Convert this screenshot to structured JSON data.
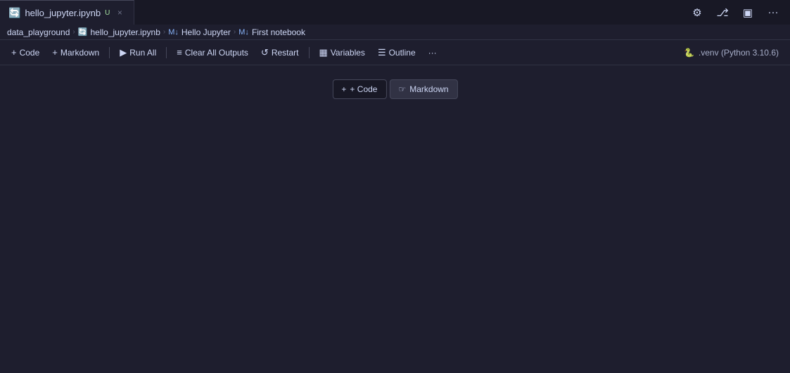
{
  "tab": {
    "icon": "🔄",
    "label": "hello_jupyter.ipynb",
    "dirty_indicator": "U",
    "close_label": "×"
  },
  "top_icons": {
    "settings": "⚙",
    "source_control": "⎇",
    "layout": "⊞",
    "more": "···"
  },
  "breadcrumb": {
    "root": "data_playground",
    "file": "hello_jupyter.ipynb",
    "section1": "Hello Jupyter",
    "section2": "First notebook",
    "sep": "›",
    "file_icon": "🔄",
    "md_icon1": "M↓",
    "md_icon2": "M↓"
  },
  "toolbar": {
    "code_label": "+ Code",
    "markdown_label": "+ Markdown",
    "run_all_label": "▶ Run All",
    "clear_all_label": "Clear All Outputs",
    "restart_label": "↺ Restart",
    "variables_label": "Variables",
    "outline_label": "Outline",
    "more_label": "···",
    "kernel_label": ".venv (Python 3.10.6)"
  },
  "floating": {
    "code_label": "+ Code",
    "markdown_label": "Markdown"
  },
  "colors": {
    "bg": "#1e1e2e",
    "tab_bg": "#181825",
    "border": "#313244",
    "accent": "#89b4fa",
    "text": "#cdd6f4",
    "muted": "#a6adc8"
  }
}
